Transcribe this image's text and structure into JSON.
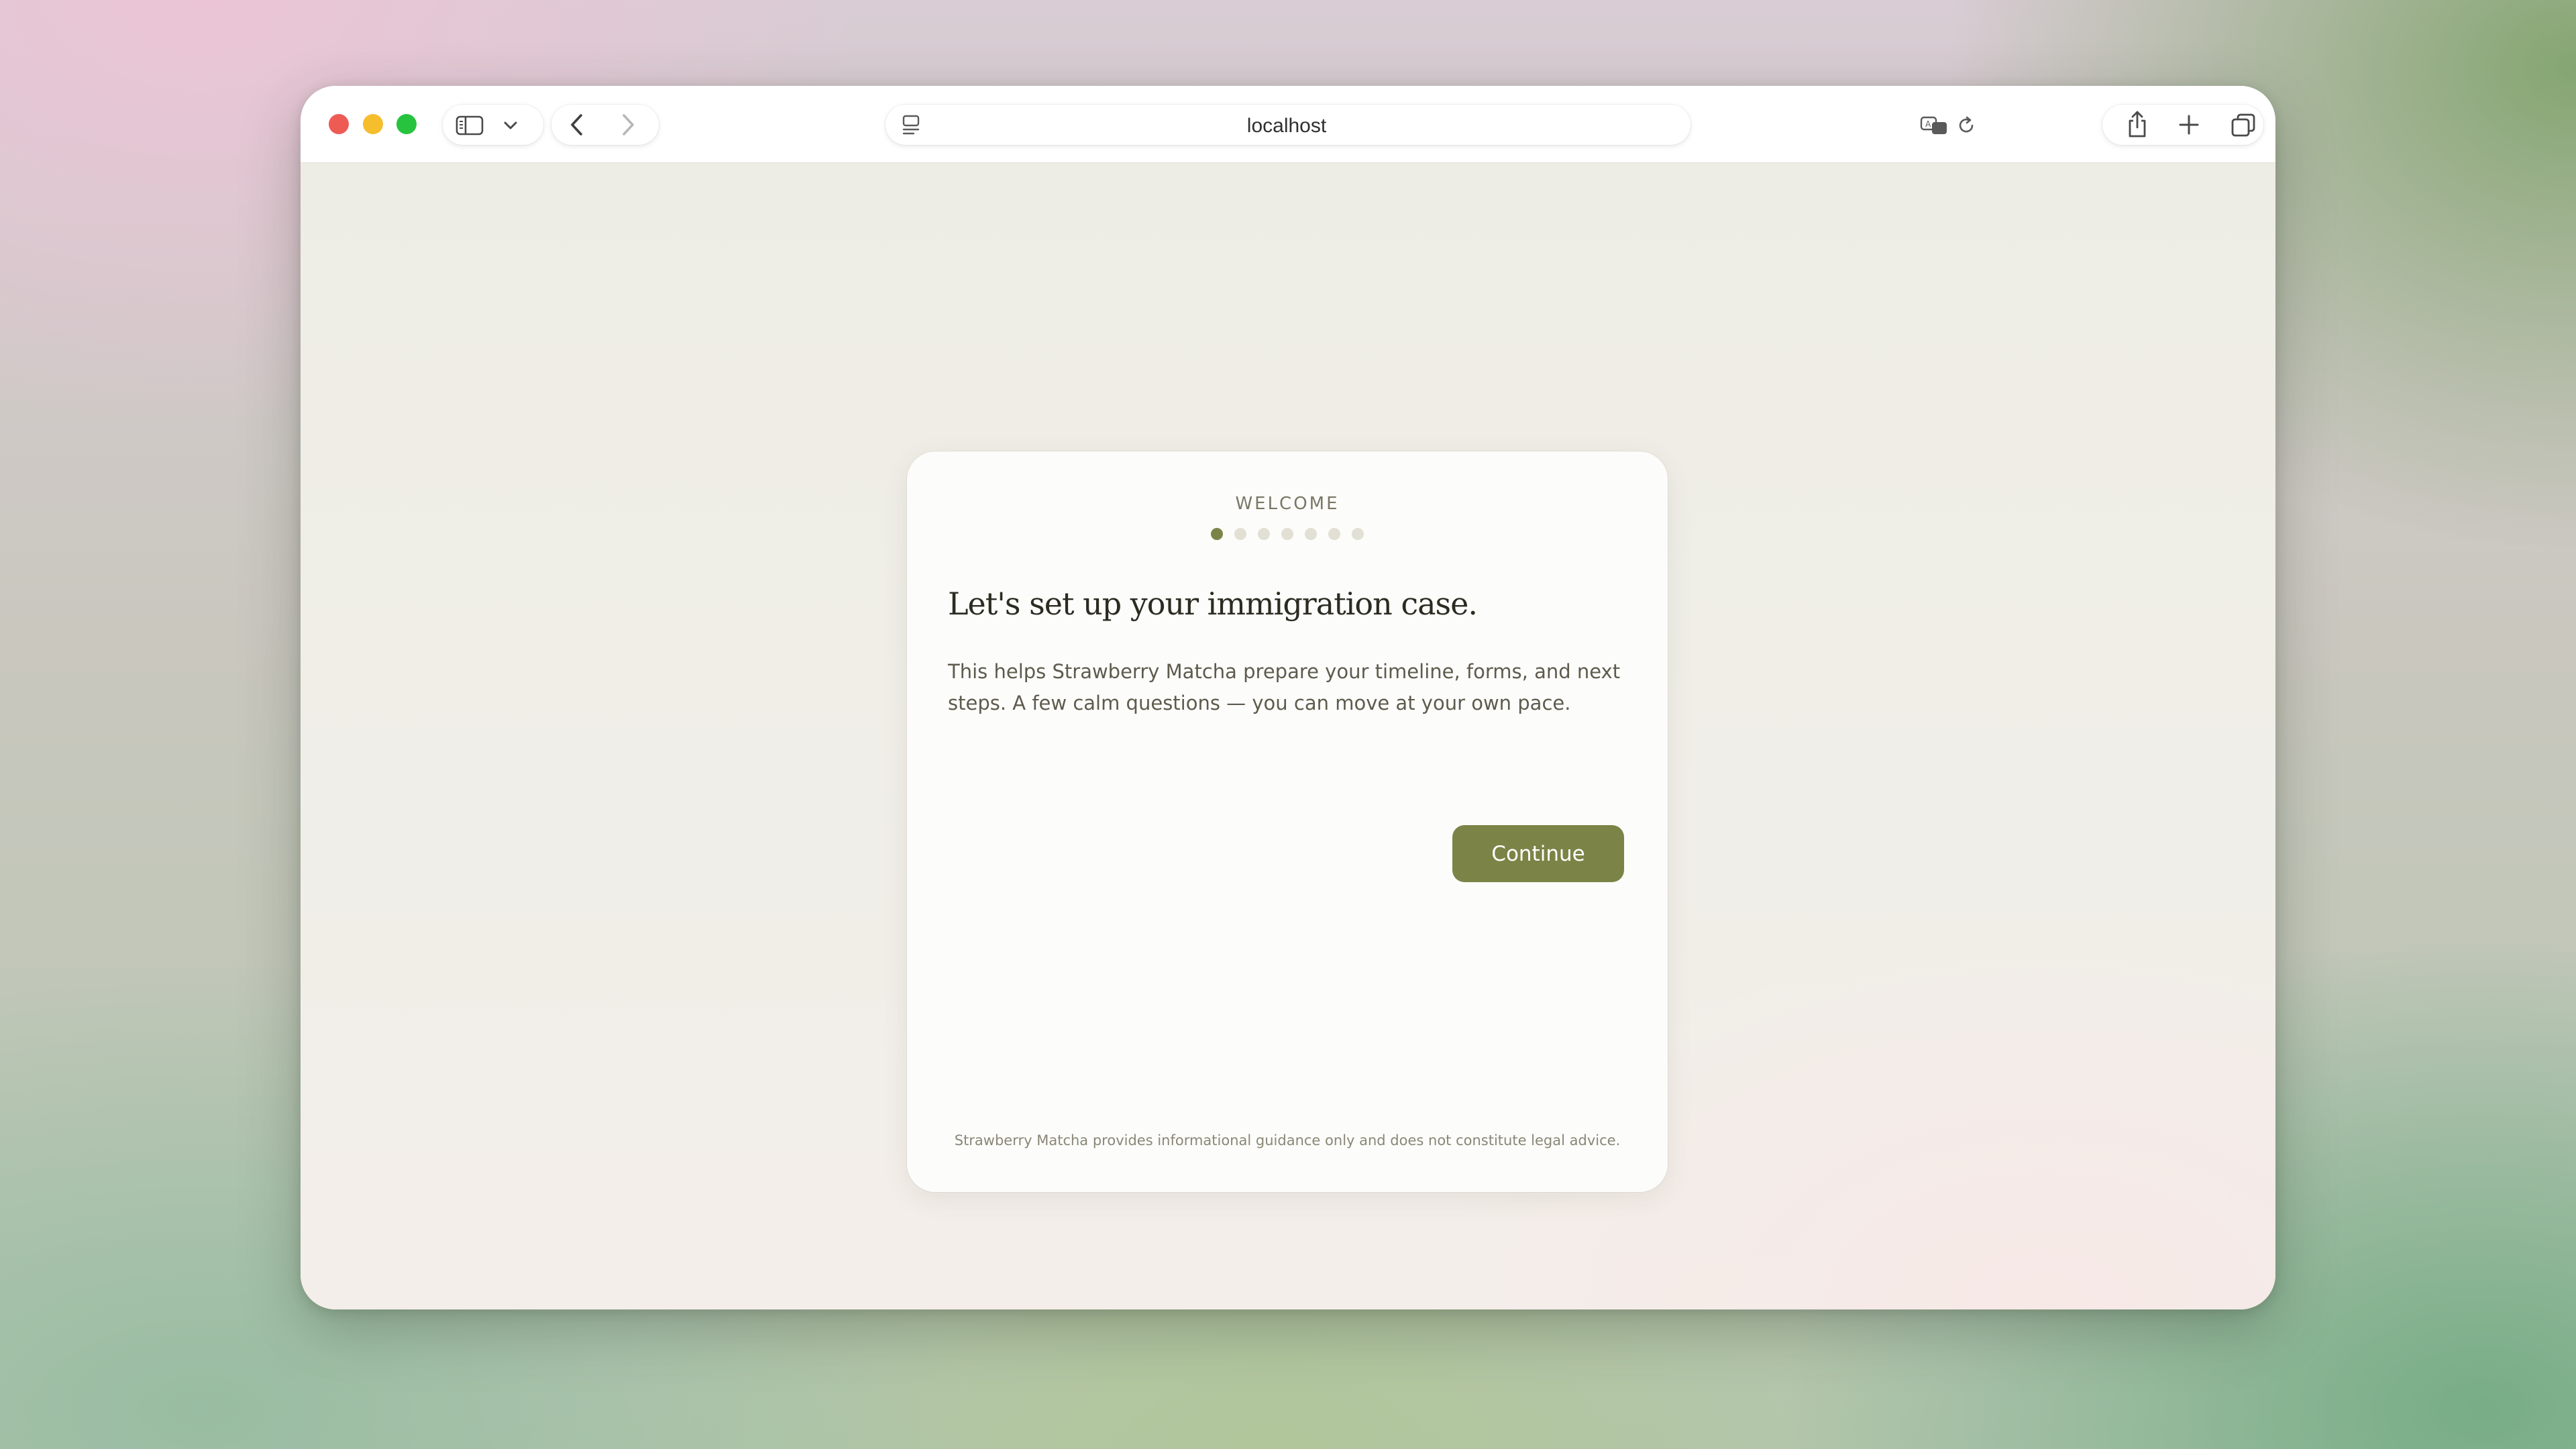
{
  "browser": {
    "address": "localhost"
  },
  "onboarding": {
    "step_label": "WELCOME",
    "steps_total": 7,
    "current_step": 1,
    "title": "Let's set up your immigration case.",
    "description": "This helps Strawberry Matcha prepare your timeline, forms, and next steps. A few calm questions — you can move at your own pace.",
    "continue_label": "Continue",
    "disclaimer": "Strawberry Matcha provides informational guidance only and does not constitute legal advice."
  },
  "colors": {
    "accent": "#7b8446",
    "dot_inactive": "#e2e0d4",
    "close": "#ee5b55",
    "minimize": "#f6bd2d",
    "zoom": "#27c33e"
  },
  "icons": {
    "sidebar": "sidebar-icon",
    "dropdown": "chevron-down-icon",
    "back": "chevron-left-icon",
    "forward": "chevron-right-icon",
    "page": "page-icon",
    "translate": "translate-icon",
    "reload": "reload-icon",
    "share": "share-icon",
    "new_tab": "plus-icon",
    "tabs": "tabs-overview-icon"
  }
}
